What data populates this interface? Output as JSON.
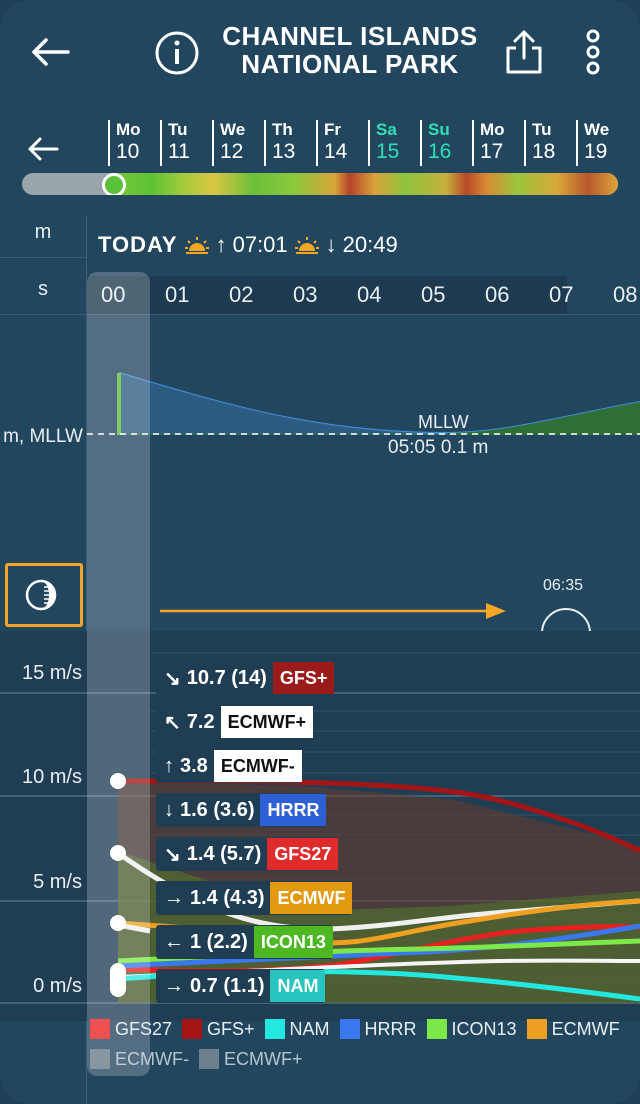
{
  "header": {
    "title_line1": "CHANNEL ISLANDS",
    "title_line2": "NATIONAL PARK",
    "back_icon": "arrow-left-icon",
    "info_icon": "info-icon",
    "share_icon": "share-icon",
    "menu_icon": "more-vertical-icon"
  },
  "days": [
    {
      "name": "Mo",
      "date": "10",
      "weekend": false
    },
    {
      "name": "Tu",
      "date": "11",
      "weekend": false
    },
    {
      "name": "We",
      "date": "12",
      "weekend": false
    },
    {
      "name": "Th",
      "date": "13",
      "weekend": false
    },
    {
      "name": "Fr",
      "date": "14",
      "weekend": false
    },
    {
      "name": "Sa",
      "date": "15",
      "weekend": true
    },
    {
      "name": "Su",
      "date": "16",
      "weekend": true
    },
    {
      "name": "Mo",
      "date": "17",
      "weekend": false
    },
    {
      "name": "Tu",
      "date": "18",
      "weekend": false
    },
    {
      "name": "We",
      "date": "19",
      "weekend": false
    }
  ],
  "left_labels": {
    "m": "m",
    "s": "s",
    "tide": "m, MLLW"
  },
  "today": {
    "label": "TODAY",
    "sunrise": "07:01",
    "sunset": "20:49"
  },
  "hours": [
    "00",
    "01",
    "02",
    "03",
    "04",
    "05",
    "06",
    "07",
    "08"
  ],
  "tide": {
    "low_label": "MLLW",
    "low_detail": "05:05 0.1 m"
  },
  "moon": {
    "time": "06:35"
  },
  "wind_axis": [
    "15 m/s",
    "10 m/s",
    "5 m/s",
    "0 m/s"
  ],
  "wind_tooltips": [
    {
      "arrow": "↘",
      "value": "10.7 (14)",
      "model": "GFS+",
      "bg": "#9b1b1b",
      "fg": "#ffffff"
    },
    {
      "arrow": "↖",
      "value": "7.2",
      "model": "ECMWF+",
      "bg": "#ffffff",
      "fg": "#111111"
    },
    {
      "arrow": "↑",
      "value": "3.8",
      "model": "ECMWF-",
      "bg": "#ffffff",
      "fg": "#111111"
    },
    {
      "arrow": "↓",
      "value": "1.6 (3.6)",
      "model": "HRRR",
      "bg": "#2d5fd6",
      "fg": "#ffffff"
    },
    {
      "arrow": "↘",
      "value": "1.4 (5.7)",
      "model": "GFS27",
      "bg": "#e02b2b",
      "fg": "#ffffff"
    },
    {
      "arrow": "→",
      "value": "1.4 (4.3)",
      "model": "ECMWF",
      "bg": "#e39a12",
      "fg": "#ffffff"
    },
    {
      "arrow": "←",
      "value": "1 (2.2)",
      "model": "ICON13",
      "bg": "#4db824",
      "fg": "#ffffff"
    },
    {
      "arrow": "→",
      "value": "0.7 (1.1)",
      "model": "NAM",
      "bg": "#28c4c0",
      "fg": "#ffffff"
    }
  ],
  "legend": [
    {
      "label": "GFS27",
      "color": "#f05050"
    },
    {
      "label": "GFS+",
      "color": "#a51515"
    },
    {
      "label": "NAM",
      "color": "#22e8e0"
    },
    {
      "label": "HRRR",
      "color": "#3a78f0"
    },
    {
      "label": "ICON13",
      "color": "#7de84a"
    },
    {
      "label": "ECMWF",
      "color": "#f0a020"
    },
    {
      "label": "ECMWF-",
      "color": "#c8c8c8"
    },
    {
      "label": "ECMWF+",
      "color": "#c8c8c8"
    }
  ]
}
